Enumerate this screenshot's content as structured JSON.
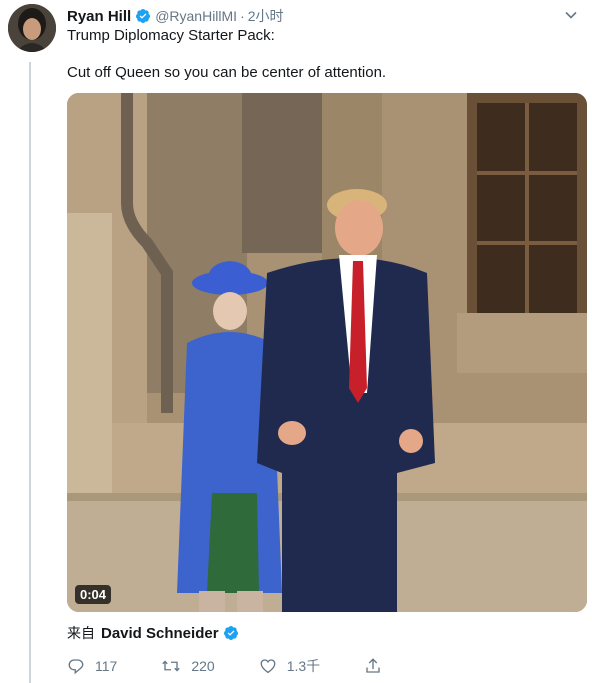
{
  "tweet": {
    "author_name": "Ryan Hill",
    "author_handle": "@RyanHillMI",
    "separator": "·",
    "time": "2小时",
    "text_line1": "Trump Diplomacy Starter Pack:",
    "text_line2": "Cut off Queen so you can be center of attention.",
    "video_duration": "0:04",
    "from_prefix": "来自",
    "from_name": "David Schneider",
    "replies": "117",
    "retweets": "220",
    "likes": "1.3千"
  },
  "colors": {
    "verified_blue": "#1da1f2",
    "secondary_text": "#657786",
    "thread_line": "#ccd6dd"
  },
  "icons": [
    "verified-badge-icon",
    "chevron-down-icon",
    "reply-icon",
    "retweet-icon",
    "like-icon",
    "share-icon"
  ]
}
